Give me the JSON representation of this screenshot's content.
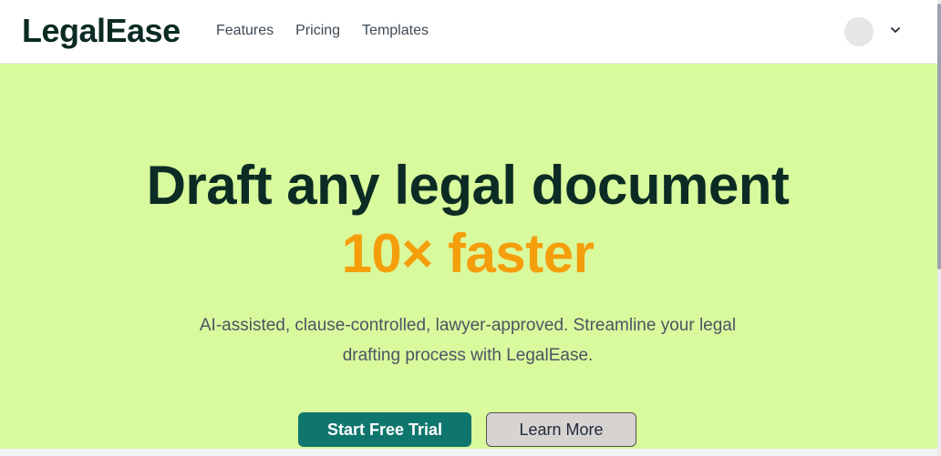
{
  "navbar": {
    "brand": "LegalEase",
    "links": [
      "Features",
      "Pricing",
      "Templates"
    ]
  },
  "hero": {
    "headline": "Draft any legal document",
    "headline_accent": "10× faster",
    "subtext_line1": "AI-assisted, clause-controlled, lawyer-approved. Streamline your legal",
    "subtext_line2": "drafting process with LegalEase.",
    "primary_button": "Start Free Trial",
    "secondary_button": "Learn More"
  },
  "colors": {
    "hero_background": "#d9f99d",
    "brand_text": "#0b2b24",
    "accent": "#f59e0b",
    "primary_button": "#0f766e"
  },
  "icons": {
    "avatar": "user-avatar",
    "menu_toggle": "chevron-down-icon"
  }
}
